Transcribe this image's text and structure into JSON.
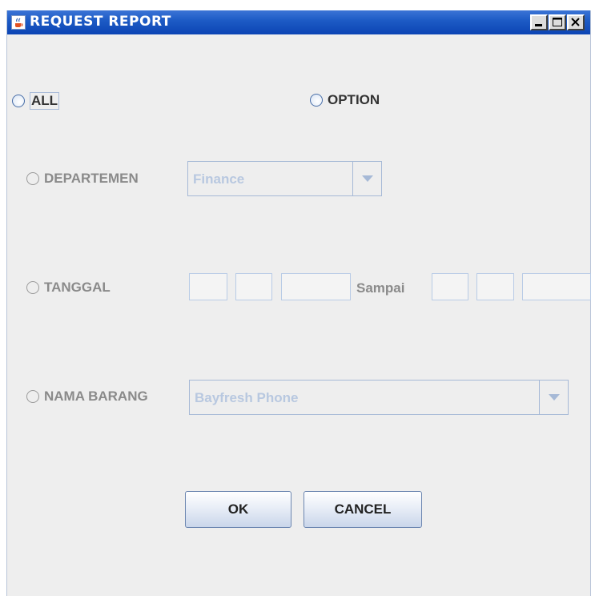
{
  "window": {
    "title": "REQUEST REPORT",
    "minimize_icon": "minimize-icon",
    "maximize_icon": "maximize-icon",
    "close_icon": "close-icon"
  },
  "mode": {
    "all_label": "ALL",
    "option_label": "OPTION"
  },
  "filters": {
    "departemen": {
      "label": "DEPARTEMEN",
      "selected": "Finance"
    },
    "tanggal": {
      "label": "TANGGAL",
      "from": {
        "day": "",
        "month": "",
        "year": ""
      },
      "separator": "Sampai",
      "to": {
        "day": "",
        "month": "",
        "year": ""
      }
    },
    "nama_barang": {
      "label": "NAMA BARANG",
      "selected": "Bayfresh Phone"
    }
  },
  "actions": {
    "ok_label": "OK",
    "cancel_label": "CANCEL"
  },
  "colors": {
    "titlebar": "#0b44b4",
    "window_bg": "#eeeeee",
    "disabled_text": "#8a8a8a",
    "disabled_field_text": "#b8c8e0"
  }
}
